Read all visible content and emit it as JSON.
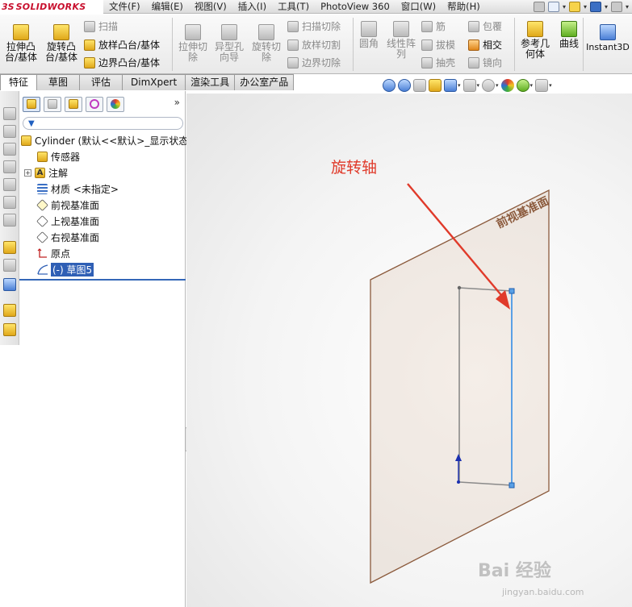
{
  "app": {
    "logo_ds": "3S",
    "logo_name": "SOLIDWORKS"
  },
  "menu": [
    "文件(F)",
    "编辑(E)",
    "视图(V)",
    "插入(I)",
    "工具(T)",
    "PhotoView 360",
    "窗口(W)",
    "帮助(H)"
  ],
  "ribbon": {
    "extrude_boss": "拉伸凸\n台/基体",
    "revolve_boss": "旋转凸\n台/基体",
    "sweep": "扫描",
    "loft_boss": "放样凸台/基体",
    "boundary_boss": "边界凸台/基体",
    "extrude_cut": "拉伸切\n除",
    "hole_wizard": "异型孔\n向导",
    "revolve_cut": "旋转切\n除",
    "sweep_cut": "扫描切除",
    "loft_cut": "放样切割",
    "boundary_cut": "边界切除",
    "fillet": "圆角",
    "linear_pattern": "线性阵\n列",
    "rib": "筋",
    "draft": "拔模",
    "shell": "抽壳",
    "wrap": "包覆",
    "intersect": "相交",
    "mirror": "镜向",
    "ref_geometry": "参考几\n何体",
    "curves": "曲线",
    "instant3d": "Instant3D"
  },
  "tabs": [
    "特征",
    "草图",
    "评估",
    "DimXpert",
    "渲染工具",
    "办公室产品"
  ],
  "feature_tree": {
    "more": "»",
    "root": "Cylinder  (默认<<默认>_显示状态",
    "items": [
      "传感器",
      "注解",
      "材质 <未指定>",
      "前视基准面",
      "上视基准面",
      "右视基准面",
      "原点",
      "(-) 草图5"
    ]
  },
  "viewport": {
    "annotation": "旋转轴",
    "plane_label": "前视基准面",
    "annotation_color": "#e03a2a",
    "plane_border_color": "#8b5a3c",
    "axis_line_color": "#5aa0e6"
  },
  "watermark": {
    "brand": "Bai 经验",
    "url": "jingyan.baidu.com"
  }
}
